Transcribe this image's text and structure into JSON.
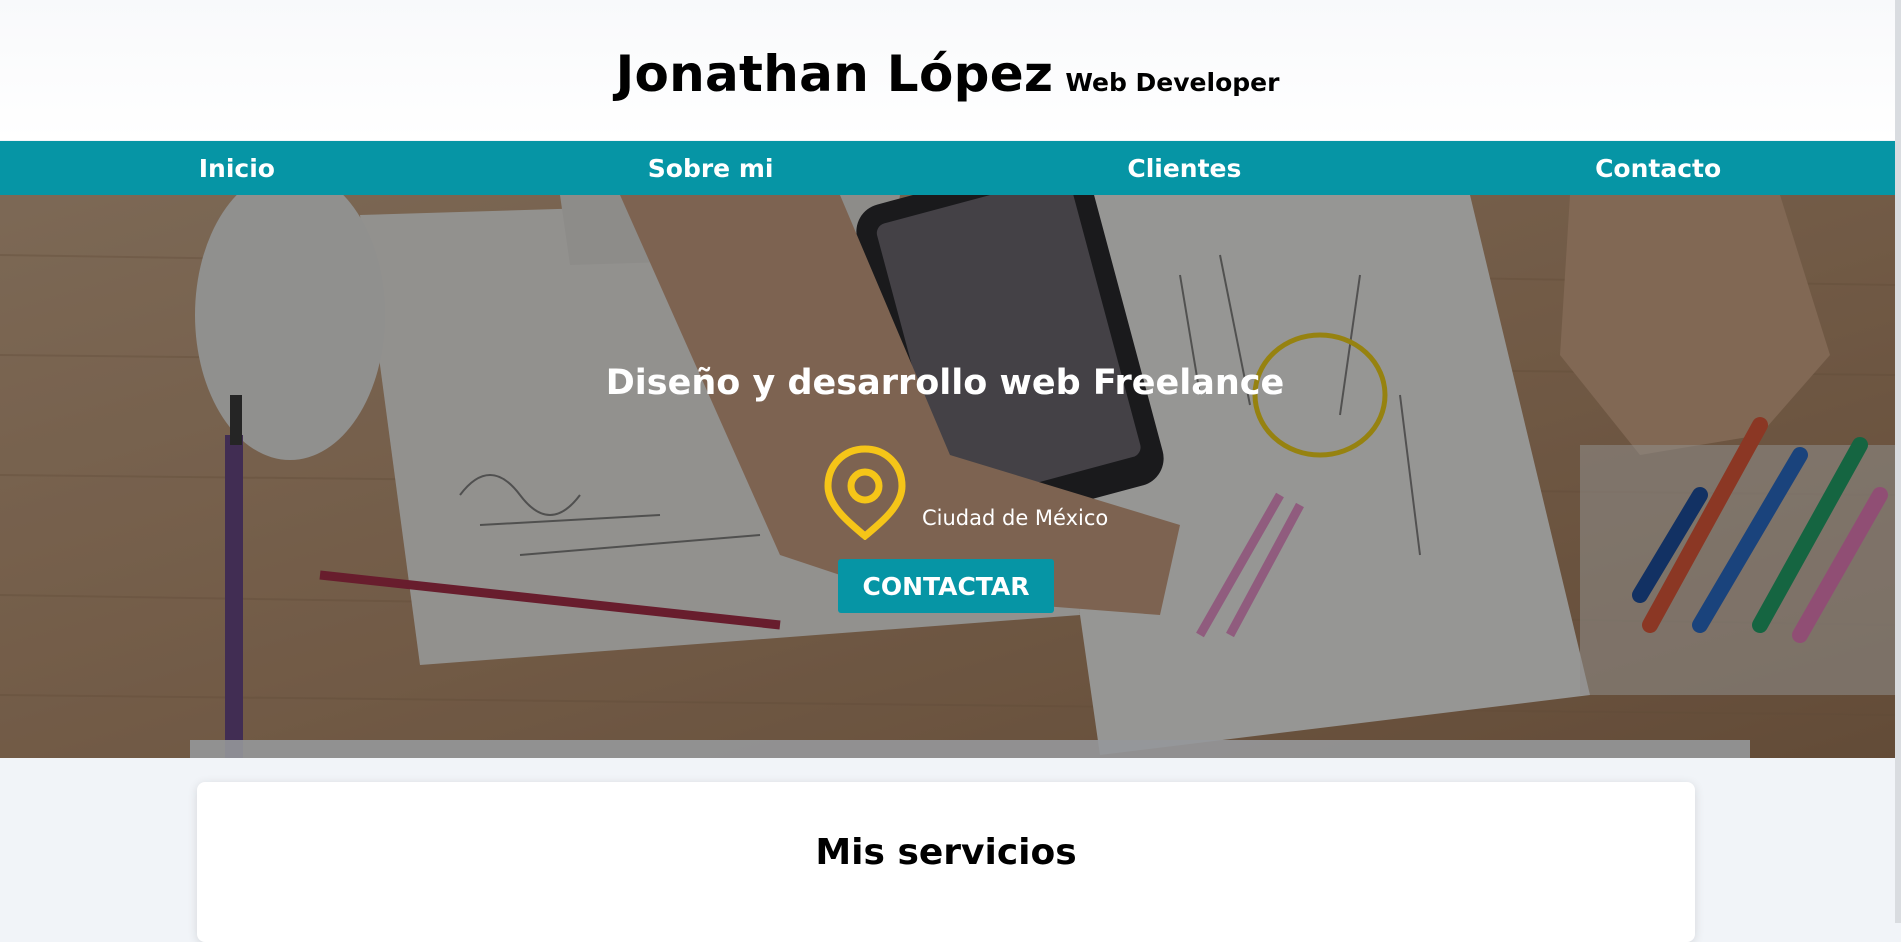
{
  "stray_char": "<",
  "header": {
    "name": "Jonathan López",
    "subtitle": "Web Developer"
  },
  "nav": {
    "items": [
      {
        "label": "Inicio"
      },
      {
        "label": "Sobre mi"
      },
      {
        "label": "Clientes"
      },
      {
        "label": "Contacto"
      }
    ]
  },
  "hero": {
    "title": "Diseño y desarrollo web Freelance",
    "location": "Ciudad de México",
    "location_icon": "map-pin-icon",
    "cta_label": "CONTACTAR"
  },
  "services": {
    "title": "Mis servicios"
  },
  "colors": {
    "accent": "#0695a5",
    "pin": "#f5c518",
    "page_bg": "#f1f4f8"
  }
}
